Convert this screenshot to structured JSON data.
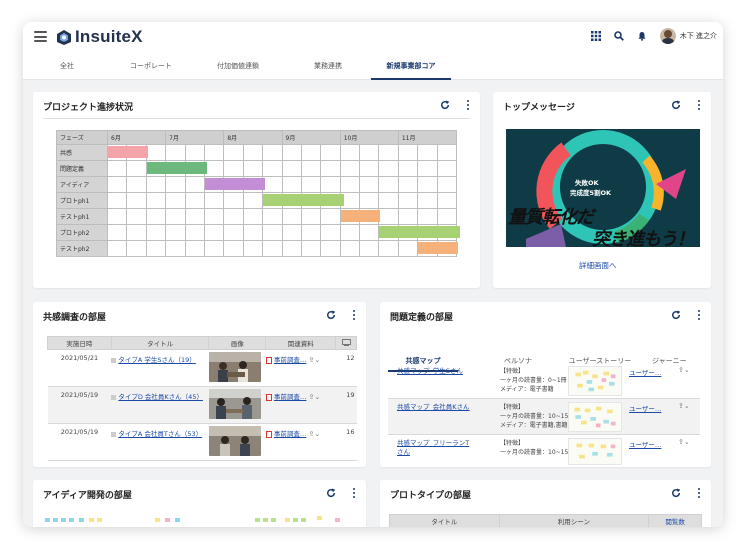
{
  "header": {
    "logo_text": "InsuiteX",
    "user_name": "木下 進之介"
  },
  "tabs": [
    {
      "label": "全社"
    },
    {
      "label": "コーポレート"
    },
    {
      "label": "付加価値連鎖"
    },
    {
      "label": "業務連携"
    },
    {
      "label": "新規事業部コア",
      "active": true
    }
  ],
  "project": {
    "title": "プロジェクト進捗状況",
    "phase_header": "フェーズ",
    "months": [
      "6月",
      "7月",
      "8月",
      "9月",
      "10月",
      "11月"
    ],
    "phases": [
      {
        "name": "共感",
        "start": 0,
        "length": 2,
        "color": "#f4a3a8"
      },
      {
        "name": "問題定義",
        "start": 2,
        "length": 3,
        "color": "#6db87d"
      },
      {
        "name": "アイディア",
        "start": 5,
        "length": 3,
        "color": "#c48ed6"
      },
      {
        "name": "プロトph1",
        "start": 8,
        "length": 4,
        "color": "#a8d174"
      },
      {
        "name": "テストph1",
        "start": 12,
        "length": 2,
        "color": "#f6b07a"
      },
      {
        "name": "プロトph2",
        "start": 14,
        "length": 4,
        "color": "#a8d174"
      },
      {
        "name": "テストph2",
        "start": 16,
        "length": 2,
        "color": "#f6b07a"
      }
    ]
  },
  "top_message": {
    "title": "トップメッセージ",
    "line1": "失敗OK",
    "line2": "完成度5割OK",
    "big1": "量質転化だ",
    "big2": "突き進もう！",
    "detail_link": "詳細画面へ"
  },
  "empathy": {
    "title": "共感調査の部屋",
    "columns": [
      "実施日時",
      "タイトル",
      "画像",
      "関連資料"
    ],
    "rows": [
      {
        "date": "2021/05/21",
        "title": "タイプA 学生Sさん（19）",
        "doc": "事前調査…",
        "count": "12"
      },
      {
        "date": "2021/05/19",
        "title": "タイプD 会社員Kさん（45）",
        "doc": "事前調査…",
        "count": "19"
      },
      {
        "date": "2021/05/19",
        "title": "タイプA 会社員Tさん（53）",
        "doc": "事前調査…",
        "count": "16"
      }
    ]
  },
  "problem": {
    "title": "問題定義の部屋",
    "subtabs": [
      "共感マップ",
      "ペルソナ",
      "ユーザーストーリー",
      "ジャーニー"
    ],
    "rows": [
      {
        "link": "共感マップ_学生Sさん",
        "line1": "【特徴】",
        "line2": "一ヶ月の読書量：0~1冊",
        "line3": "メディア：電子書籍",
        "doc": "ユーザー…"
      },
      {
        "link": "共感マップ_会社員Kさん",
        "line1": "【特徴】",
        "line2": "一ヶ月の読書量：10~15冊",
        "line3": "メディア：電子書籍,書籍",
        "doc": "ユーザー…"
      },
      {
        "link": "共感マップ_フリーランTさん",
        "line1": "【特徴】",
        "line2": "一ヶ月の読書量：10~15冊",
        "line3": "",
        "doc": "ユーザー…"
      }
    ]
  },
  "idea": {
    "title": "アイディア開発の部屋"
  },
  "prototype": {
    "title": "プロトタイプの部屋",
    "columns": [
      "タイトル",
      "利用シーン",
      "閲覧数"
    ]
  },
  "colors": {
    "brand": "#1b3a6b",
    "link": "#1b4aa8",
    "background": "#f1f2f4"
  },
  "icons": [
    "menu-icon",
    "grid-icon",
    "search-icon",
    "bell-icon",
    "refresh-icon",
    "more-icon",
    "share-icon",
    "chevron-down-icon",
    "pdf-icon"
  ]
}
